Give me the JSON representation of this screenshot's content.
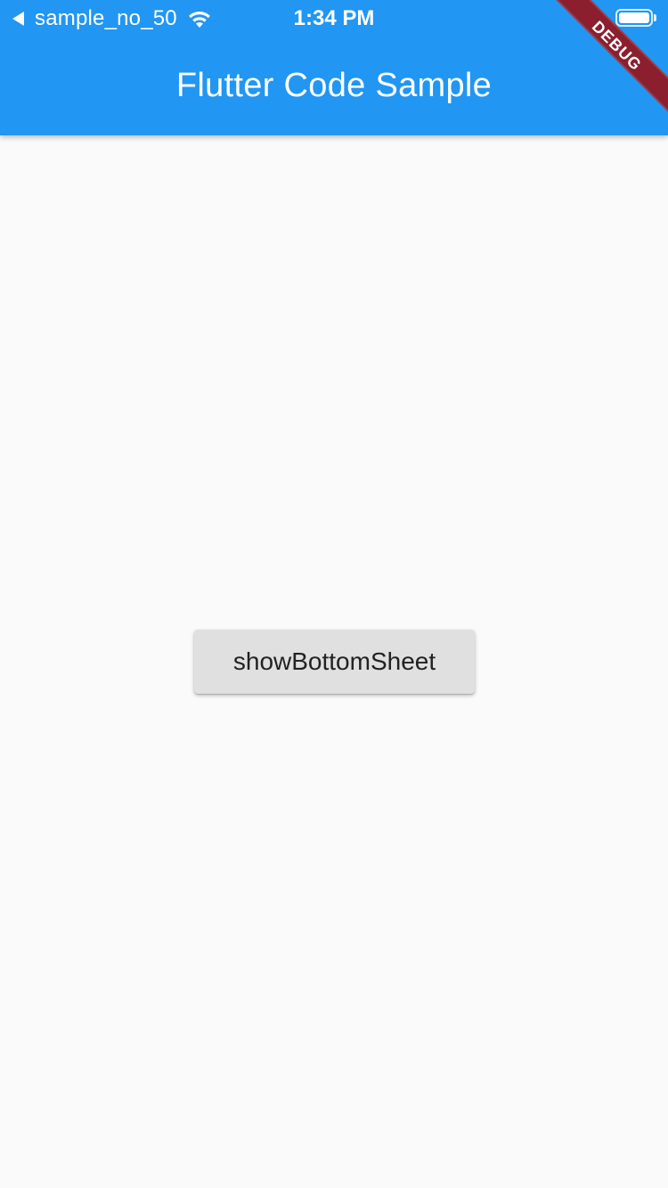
{
  "status_bar": {
    "back_app_label": "sample_no_50",
    "time": "1:34 PM",
    "battery_level": 1.0
  },
  "app_bar": {
    "title": "Flutter Code Sample",
    "background_color": "#2196f3"
  },
  "debug_banner": {
    "label": "DEBUG",
    "color": "#8b1f2e"
  },
  "main": {
    "button_label": "showBottomSheet",
    "background_color": "#fafafa"
  },
  "icons": {
    "back": "back-arrow-icon",
    "wifi": "wifi-icon",
    "battery": "battery-icon"
  }
}
